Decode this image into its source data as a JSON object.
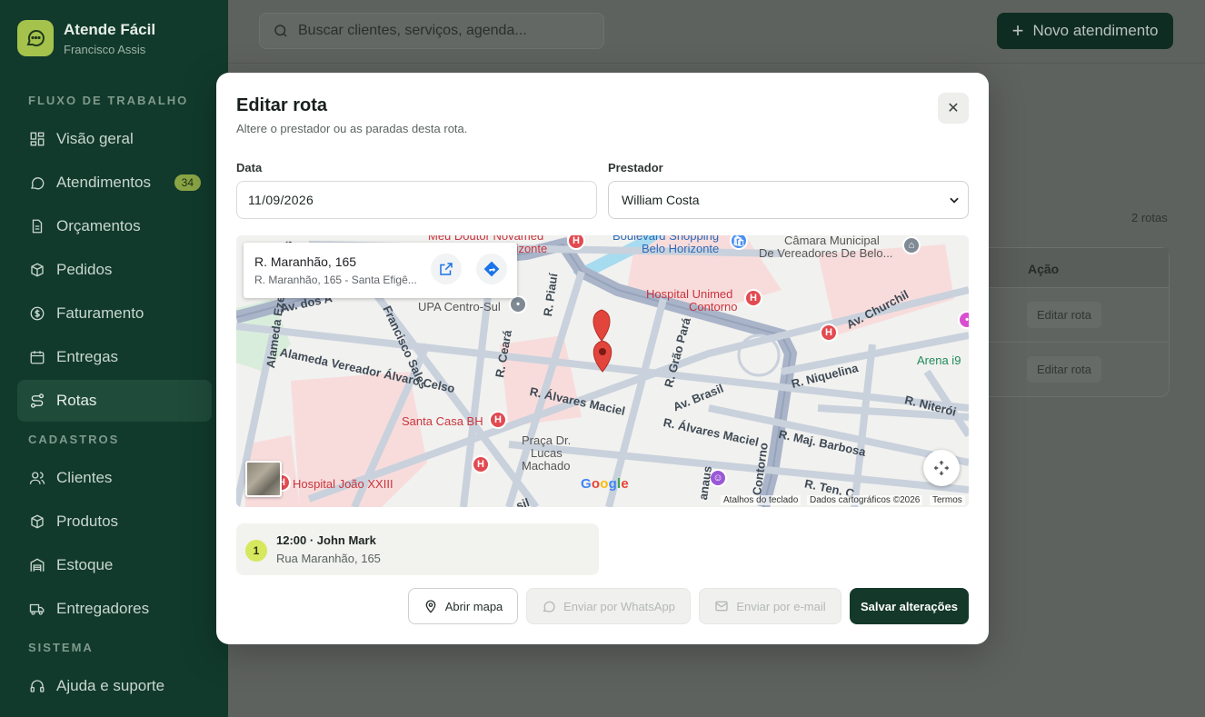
{
  "app": {
    "name": "Atende Fácil",
    "user": "Francisco Assis"
  },
  "sidebar": {
    "section_workflow": "FLUXO DE TRABALHO",
    "section_registry": "CADASTROS",
    "section_system": "SISTEMA",
    "items": [
      {
        "label": "Visão geral",
        "icon": "grid-icon"
      },
      {
        "label": "Atendimentos",
        "icon": "chat-icon",
        "badge": "34"
      },
      {
        "label": "Orçamentos",
        "icon": "document-icon"
      },
      {
        "label": "Pedidos",
        "icon": "box-icon"
      },
      {
        "label": "Faturamento",
        "icon": "dollar-icon"
      },
      {
        "label": "Entregas",
        "icon": "calendar-icon"
      },
      {
        "label": "Rotas",
        "icon": "route-icon",
        "active": true
      },
      {
        "label": "Clientes",
        "icon": "users-icon"
      },
      {
        "label": "Produtos",
        "icon": "box-icon"
      },
      {
        "label": "Estoque",
        "icon": "warehouse-icon"
      },
      {
        "label": "Entregadores",
        "icon": "truck-icon"
      },
      {
        "label": "Ajuda e suporte",
        "icon": "headset-icon"
      }
    ]
  },
  "topbar": {
    "search_placeholder": "Buscar clientes, serviços, agenda...",
    "new_button": "Novo atendimento"
  },
  "background": {
    "route_count": "2 rotas",
    "column_action": "Ação",
    "edit_label": "Editar rota"
  },
  "modal": {
    "title": "Editar rota",
    "subtitle": "Altere o prestador ou as paradas desta rota.",
    "date_label": "Data",
    "date_value": "11/09/2026",
    "provider_label": "Prestador",
    "provider_value": "William Costa",
    "map": {
      "place_title": "R. Maranhão, 165",
      "place_address": "R. Maranhão, 165 - Santa Efigê...",
      "attribution_keyboard": "Atalhos do teclado",
      "attribution_data": "Dados cartográficos ©2026",
      "attribution_terms": "Termos",
      "labels": {
        "meu_doutor": "Meu Doutor Novamed",
        "horizonte": "orizonte",
        "boulevard": "Boulevard Shopping",
        "belo_horizonte": "Belo Horizonte",
        "camara1": "Câmara Municipal",
        "camara2": "De Vereadores De Belo...",
        "unimed1": "Hospital Unimed",
        "unimed2": "Contorno",
        "upa": "UPA Centro-Sul",
        "av_churchil": "Av. Churchil",
        "arena": "Arena i9",
        "r_piaui": "R. Piauí",
        "r_grao_para": "R. Grão Pará",
        "r_ceara": "R. Ceará",
        "fco_sales": "Francisco Sales",
        "av_dos": "Av. dos A",
        "alameda_ezequiel": "Alameda Ezequiel Dias",
        "alameda_vereador": "Alameda Vereador Álvaro Celso",
        "r_alvares_maciel": "R. Álvares Maciel",
        "r_alvares_maciel2": "R. Álvares Maciel",
        "av_brasil": "Av. Brasil",
        "r_niquelina": "R. Niquelina",
        "r_niteroi": "R. Niterói",
        "r_maj_barbosa": "R. Maj. Barbosa",
        "contorno": "Contorno",
        "santa_casa": "Santa Casa BH",
        "praca1": "Praça Dr.",
        "praca2": "Lucas",
        "praca3": "Machado",
        "joao_xxiii": "Hospital João XXIII",
        "r_ten": "R. Ten. C",
        "anaus": "anaus",
        "sil": "sil",
        "google": "Google"
      }
    },
    "stop": {
      "number": "1",
      "title": "12:00 · John Mark",
      "address": "Rua Maranhão, 165"
    },
    "buttons": {
      "open_map": "Abrir mapa",
      "whatsapp": "Enviar por WhatsApp",
      "email": "Enviar por e-mail",
      "save": "Salvar alterações"
    }
  }
}
